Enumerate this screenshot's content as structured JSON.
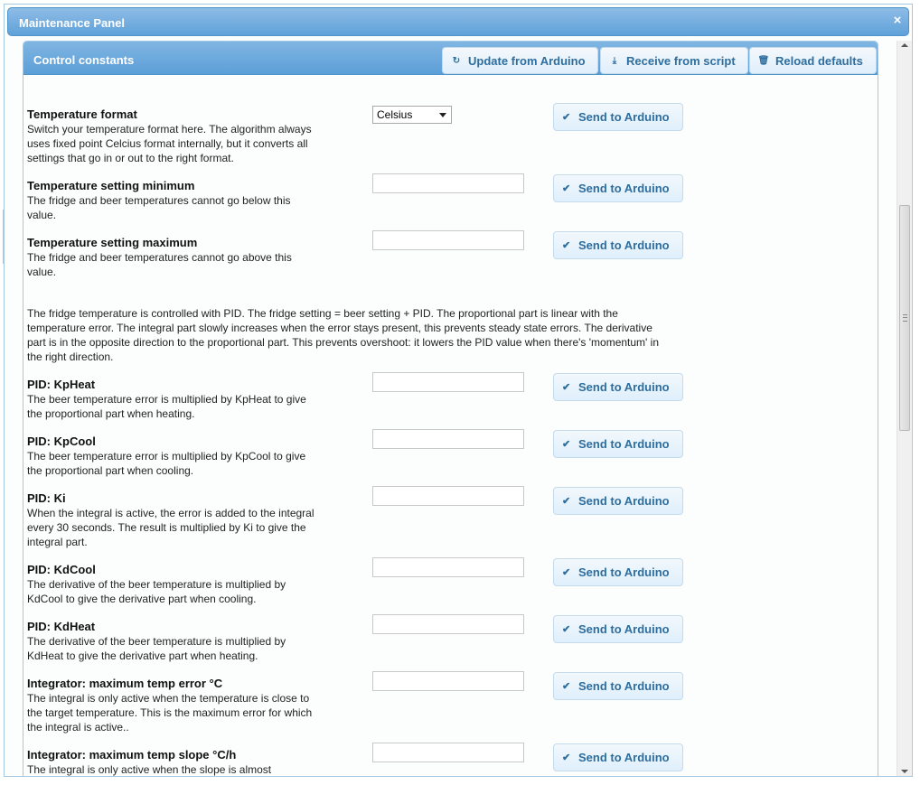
{
  "dialog": {
    "title": "Maintenance Panel",
    "close_glyph": "×"
  },
  "section": {
    "title": "Control constants",
    "buttons": [
      {
        "label": "Update from Arduino",
        "icon": "refresh-icon"
      },
      {
        "label": "Receive from script",
        "icon": "download-icon"
      },
      {
        "label": "Reload defaults",
        "icon": "trash-icon"
      }
    ]
  },
  "send_label": "Send to Arduino",
  "temp_format": {
    "label": "Temperature format",
    "desc": "Switch your temperature format here. The algorithm always uses fixed point Celcius format internally, but it converts all settings that go in or out to the right format.",
    "selected": "Celsius"
  },
  "temp_min": {
    "label": "Temperature setting minimum",
    "desc": "The fridge and beer temperatures cannot go below this value.",
    "value": ""
  },
  "temp_max": {
    "label": "Temperature setting maximum",
    "desc": "The fridge and beer temperatures cannot go above this value.",
    "value": ""
  },
  "pid_intro": "The fridge temperature is controlled with PID. The fridge setting = beer setting + PID. The proportional part is linear with the temperature error. The integral part slowly increases when the error stays present, this prevents steady state errors. The derivative part is in the opposite direction to the proportional part. This prevents overshoot: it lowers the PID value when there's 'momentum' in the right direction.",
  "kpheat": {
    "label": "PID: KpHeat",
    "desc": "The beer temperature error is multiplied by KpHeat to give the proportional part when heating.",
    "value": ""
  },
  "kpcool": {
    "label": "PID: KpCool",
    "desc": "The beer temperature error is multiplied by KpCool to give the proportional part when cooling.",
    "value": ""
  },
  "ki": {
    "label": "PID: Ki",
    "desc": "When the integral is active, the error is added to the integral every 30 seconds. The result is multiplied by Ki to give the integral part.",
    "value": ""
  },
  "kdcool": {
    "label": "PID: KdCool",
    "desc": "The derivative of the beer temperature is multiplied by KdCool to give the derivative part when cooling.",
    "value": ""
  },
  "kdheat": {
    "label": "PID: KdHeat",
    "desc": "The derivative of the beer temperature is multiplied by KdHeat to give the derivative part when heating.",
    "value": ""
  },
  "int_err": {
    "label": "Integrator: maximum temp error °C",
    "desc": "The integral is only active when the temperature is close to the target temperature. This is the maximum error for which the integral is active..",
    "value": ""
  },
  "int_slope": {
    "label": "Integrator: maximum temp slope °C/h",
    "desc": "The integral is only active when the slope is almost",
    "value": ""
  },
  "colors": {
    "header": "#5c9fd8",
    "button_text": "#2e6e9e"
  }
}
